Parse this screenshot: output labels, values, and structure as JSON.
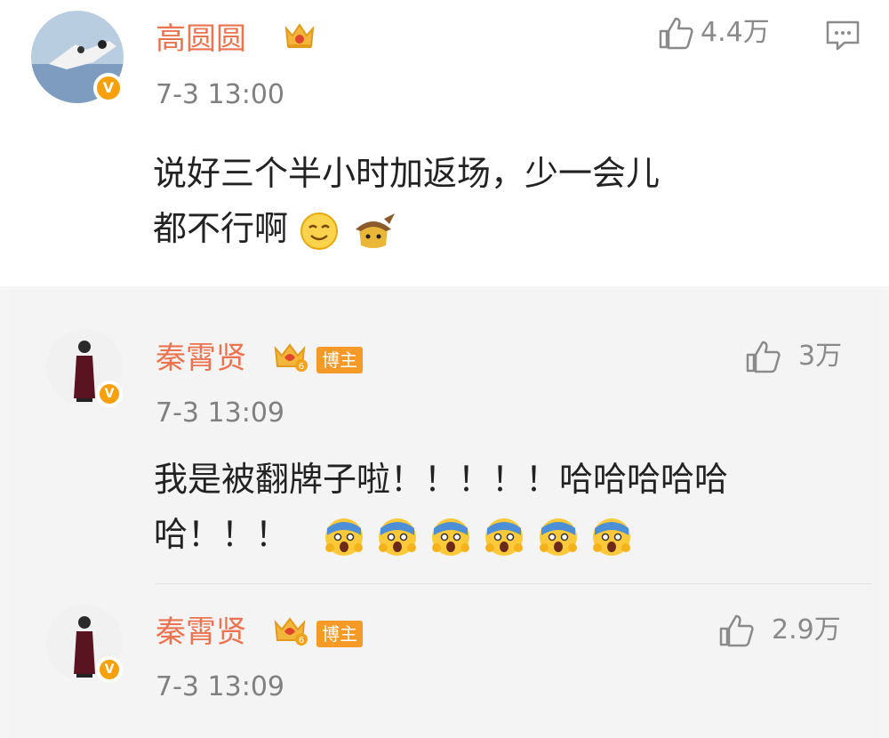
{
  "post": {
    "author": "高圆圆",
    "time": "7-3 13:00",
    "likes": "4.4万",
    "text_line1": "说好三个半小时加返场，少一会儿",
    "text_line2": "都不行啊"
  },
  "replies": [
    {
      "author": "秦霄贤",
      "badge": "博主",
      "time": "7-3 13:09",
      "likes": "3万",
      "text_line1": "我是被翻牌子啦！！！！！哈哈哈哈哈",
      "text_line2": "哈！！！"
    },
    {
      "author": "秦霄贤",
      "badge": "博主",
      "time": "7-3 13:09",
      "likes": "2.9万"
    }
  ],
  "icons": {
    "verified": "verified-v-badge",
    "crown": "crown-icon",
    "like": "thumbs-up-icon",
    "comment": "comment-icon"
  },
  "colors": {
    "name": "#eb7350",
    "verified": "#f6a10b",
    "badge": "#f59a27"
  }
}
